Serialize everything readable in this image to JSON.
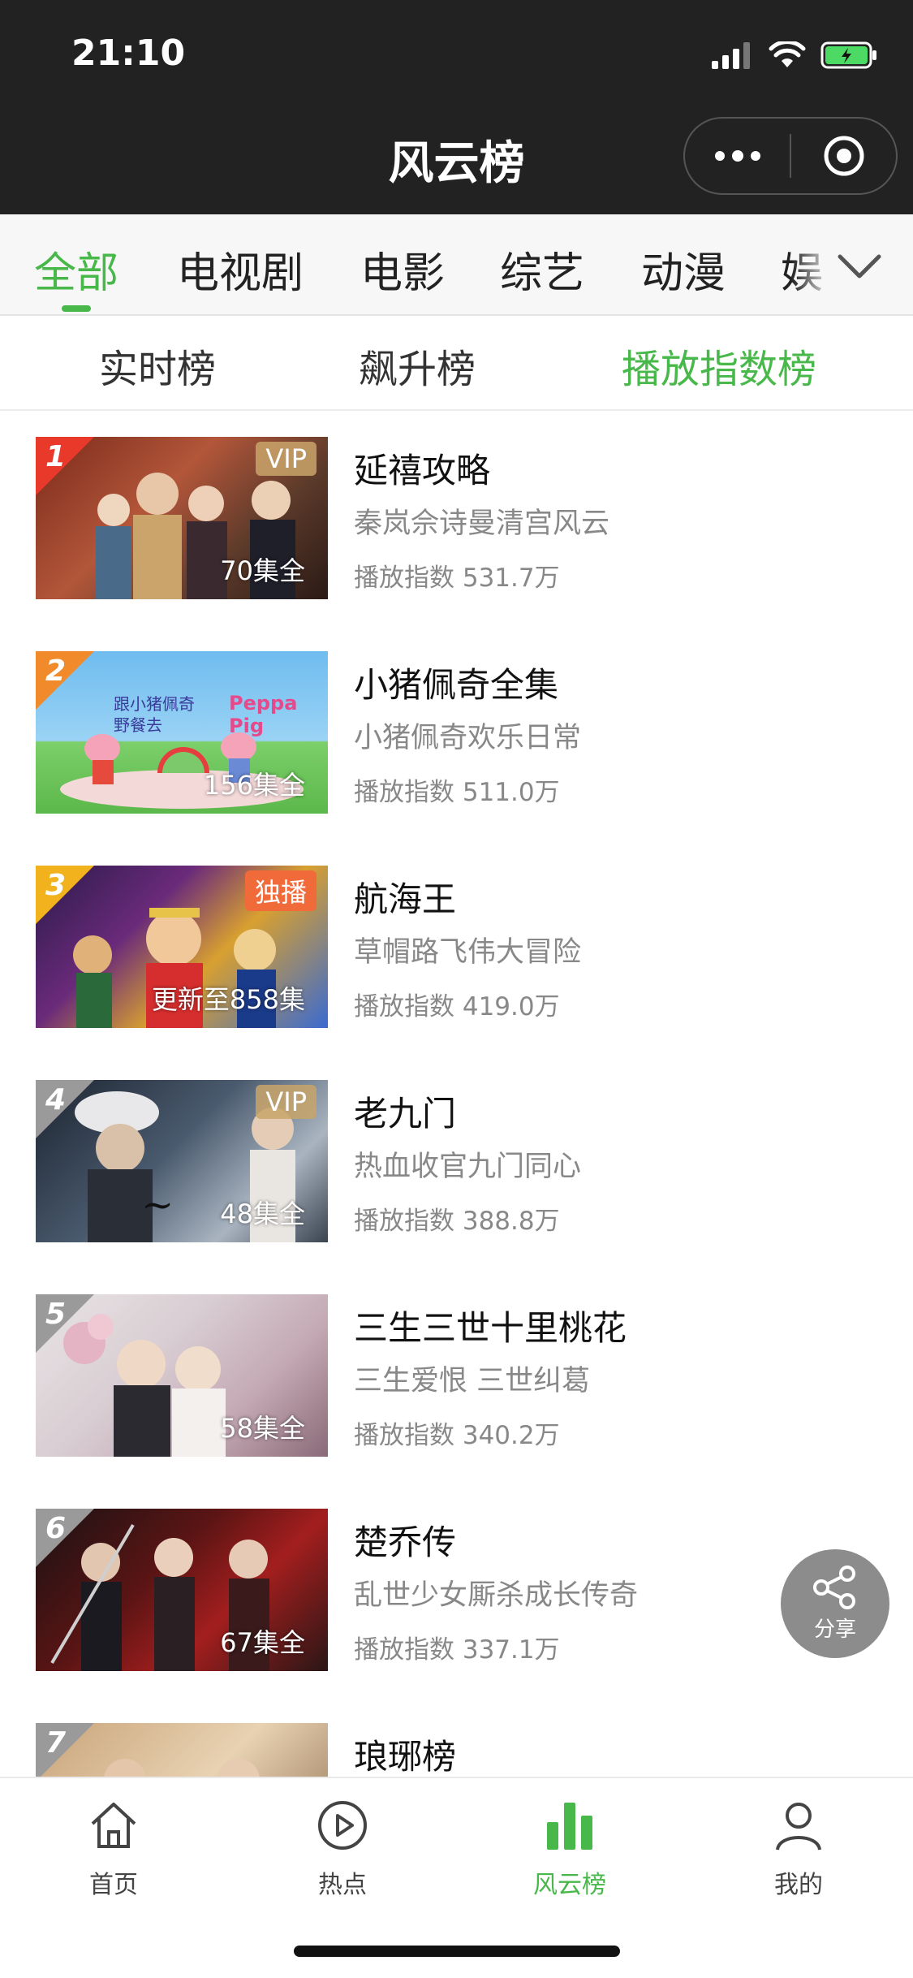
{
  "status": {
    "time": "21:10"
  },
  "nav": {
    "title": "风云榜"
  },
  "categories": [
    "全部",
    "电视剧",
    "电影",
    "综艺",
    "动漫",
    "娱"
  ],
  "subtabs": [
    "实时榜",
    "飙升榜",
    "播放指数榜"
  ],
  "list": [
    {
      "rank": "1",
      "title": "延禧攻略",
      "desc": "秦岚佘诗曼清宫风云",
      "play": "播放指数 531.7万",
      "episodes": "70集全",
      "tag": "VIP"
    },
    {
      "rank": "2",
      "title": "小猪佩奇全集",
      "desc": "小猪佩奇欢乐日常",
      "play": "播放指数 511.0万",
      "episodes": "156集全",
      "poster_text": "跟小猪佩奇 野餐去",
      "poster_logo": "Peppa Pig"
    },
    {
      "rank": "3",
      "title": "航海王",
      "desc": "草帽路飞伟大冒险",
      "play": "播放指数 419.0万",
      "episodes": "更新至858集",
      "tag": "独播"
    },
    {
      "rank": "4",
      "title": "老九门",
      "desc": "热血收官九门同心",
      "play": "播放指数 388.8万",
      "episodes": "48集全",
      "tag": "VIP"
    },
    {
      "rank": "5",
      "title": "三生三世十里桃花",
      "desc": "三生爱恨 三世纠葛",
      "play": "播放指数 340.2万",
      "episodes": "58集全"
    },
    {
      "rank": "6",
      "title": "楚乔传",
      "desc": "乱世少女厮杀成长传奇",
      "play": "播放指数 337.1万",
      "episodes": "67集全"
    },
    {
      "rank": "7",
      "title": "琅琊榜"
    }
  ],
  "share": {
    "label": "分享"
  },
  "tabbar": [
    {
      "label": "首页",
      "icon": "home-icon"
    },
    {
      "label": "热点",
      "icon": "play-circle-icon"
    },
    {
      "label": "风云榜",
      "icon": "bar-chart-icon"
    },
    {
      "label": "我的",
      "icon": "person-icon"
    }
  ],
  "colors": {
    "accent": "#48b84a",
    "topbar": "#222222",
    "vip": "#c9a46a",
    "exclusive": "#f06a3a"
  }
}
